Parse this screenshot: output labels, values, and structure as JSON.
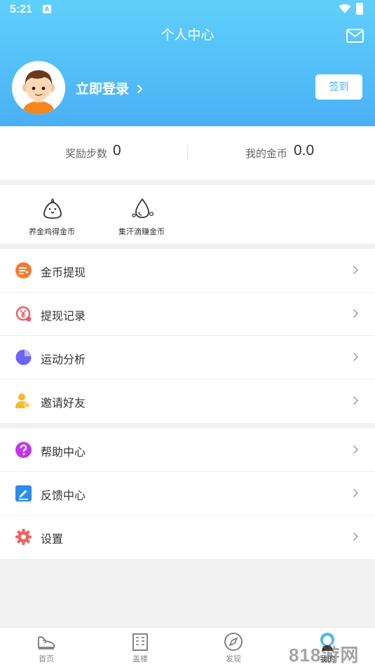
{
  "status_bar": {
    "time": "5:21",
    "sim_glyph": "A"
  },
  "header": {
    "title": "个人中心",
    "login_label": "立即登录",
    "signin_label": "签到"
  },
  "stats": {
    "steps_label": "奖励步数",
    "steps_value": "0",
    "coins_label": "我的金币",
    "coins_value": "0.0"
  },
  "tasks": [
    {
      "label": "养金鸡得金币",
      "icon": "chick-icon"
    },
    {
      "label": "集汗滴赚金币",
      "icon": "sweat-drop-icon"
    }
  ],
  "menu_group_1": [
    {
      "label": "金币提现",
      "icon": "coin-withdraw-icon",
      "color": "#f47b2e"
    },
    {
      "label": "提现记录",
      "icon": "yen-record-icon",
      "color": "#f05b6b"
    },
    {
      "label": "运动分析",
      "icon": "pie-chart-icon",
      "color": "#6c63f5"
    },
    {
      "label": "邀请好友",
      "icon": "invite-friend-icon",
      "color": "#f5b82e"
    }
  ],
  "menu_group_2": [
    {
      "label": "帮助中心",
      "icon": "help-icon",
      "color": "#c236e6"
    },
    {
      "label": "反馈中心",
      "icon": "feedback-icon",
      "color": "#2a8cf0"
    },
    {
      "label": "设置",
      "icon": "gear-icon",
      "color": "#f06060"
    }
  ],
  "tabbar": [
    {
      "label": "首页",
      "icon": "shoe-icon"
    },
    {
      "label": "盖楼",
      "icon": "building-icon"
    },
    {
      "label": "发现",
      "icon": "compass-icon"
    },
    {
      "label": "我的",
      "icon": "profile-icon",
      "active": true
    }
  ],
  "watermark": "818游网"
}
